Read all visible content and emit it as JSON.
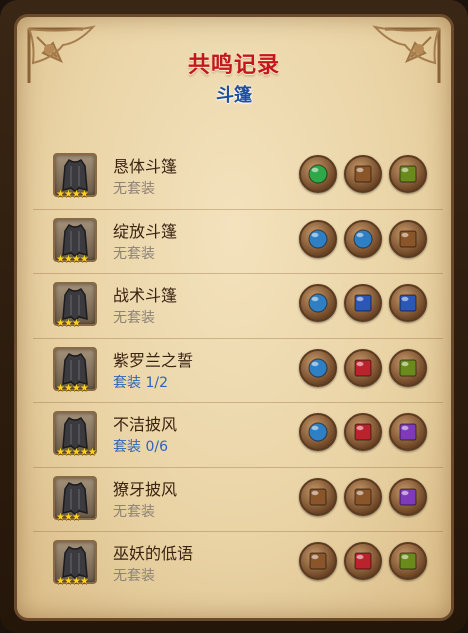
{
  "header": {
    "title": "共鸣记录",
    "subtitle": "斗篷"
  },
  "colors": {
    "green": "#2fa84a",
    "blue": "#2f7fc4",
    "sapphire": "#2a57b8",
    "red": "#b8232c",
    "purple": "#7e3ab8",
    "olive": "#6a8a1c",
    "brown": "#8a5528"
  },
  "items": [
    {
      "name": "恳体斗篷",
      "set": "无套装",
      "set_active": false,
      "stars": "★★★★",
      "gems": [
        "green-round",
        "brown-square",
        "olive-square"
      ]
    },
    {
      "name": "绽放斗篷",
      "set": "无套装",
      "set_active": false,
      "stars": "★★★★",
      "gems": [
        "blue-round",
        "blue-round",
        "brown-square"
      ]
    },
    {
      "name": "战术斗篷",
      "set": "无套装",
      "set_active": false,
      "stars": "★★★",
      "gems": [
        "blue-round",
        "sapphire-square",
        "sapphire-square"
      ]
    },
    {
      "name": "紫罗兰之誓",
      "set": "套装 1/2",
      "set_active": true,
      "stars": "★★★★",
      "gems": [
        "blue-round",
        "red-square",
        "olive-square"
      ]
    },
    {
      "name": "不洁披风",
      "set": "套装 0/6",
      "set_active": true,
      "stars": "★★★★★",
      "gems": [
        "blue-round",
        "red-square",
        "purple-square"
      ]
    },
    {
      "name": "獠牙披风",
      "set": "无套装",
      "set_active": false,
      "stars": "★★★",
      "gems": [
        "brown-square",
        "brown-square",
        "purple-square"
      ]
    },
    {
      "name": "巫妖的低语",
      "set": "无套装",
      "set_active": false,
      "stars": "★★★★",
      "gems": [
        "brown-square",
        "red-square",
        "olive-square"
      ]
    }
  ]
}
